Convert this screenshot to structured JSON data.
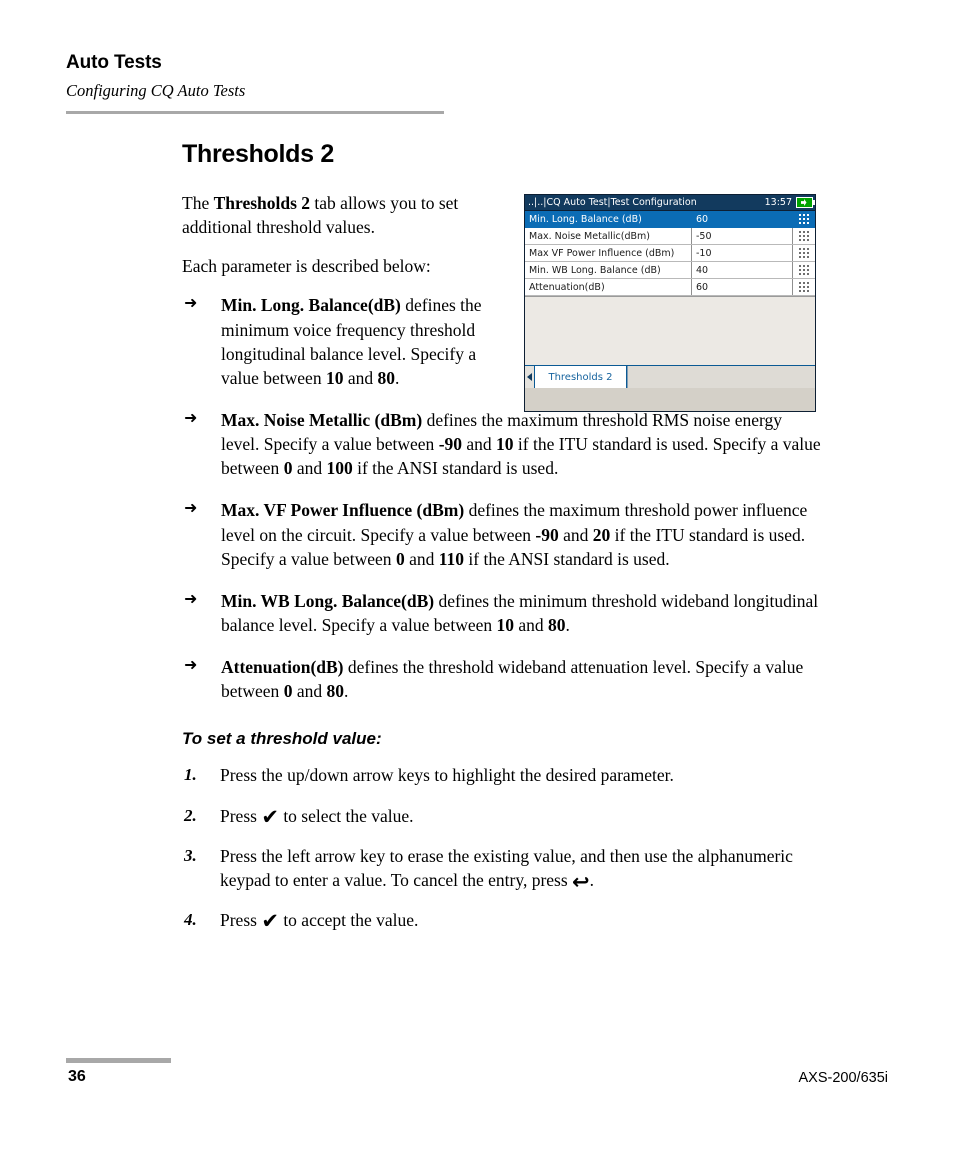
{
  "header": {
    "title": "Auto Tests",
    "subtitle": "Configuring CQ Auto Tests"
  },
  "main": {
    "section_heading": "Thresholds 2",
    "intro_p1_pre": "The ",
    "intro_p1_bold": "Thresholds 2",
    "intro_p1_post": " tab allows you to set additional threshold values.",
    "intro_p2": "Each parameter is described below:",
    "bullet_marker": "➜"
  },
  "bullets": [
    {
      "term": "Min. Long. Balance(dB)",
      "text_1": " defines the minimum voice frequency threshold longitudinal balance level. Specify a value between ",
      "v1": "10",
      "text_2": " and ",
      "v2": "80",
      "text_3": "."
    },
    {
      "term": "Max. Noise Metallic (dBm)",
      "text_1": " defines the maximum threshold RMS noise energy level. Specify a value between ",
      "v1": "-90",
      "text_2": " and ",
      "v2": "10",
      "text_3": " if the ITU standard is used. Specify a value between ",
      "v3": "0",
      "text_4": " and ",
      "v4": "100",
      "text_5": " if the ANSI standard is used."
    },
    {
      "term": "Max. VF Power Influence (dBm)",
      "text_1": " defines the maximum threshold power influence level on the circuit. Specify a value between ",
      "v1": "-90",
      "text_2": " and ",
      "v2": "20",
      "text_3": " if the ITU standard is used. Specify a value between ",
      "v3": "0",
      "text_4": " and ",
      "v4": "110",
      "text_5": " if the ANSI standard is used."
    },
    {
      "term": "Min. WB Long. Balance(dB)",
      "text_1": " defines the minimum threshold wideband longitudinal balance level. Specify a value between ",
      "v1": "10",
      "text_2": " and ",
      "v2": "80",
      "text_3": "."
    },
    {
      "term": "Attenuation(dB)",
      "text_1": " defines the threshold wideband attenuation level. Specify a value between ",
      "v1": "0",
      "text_2": " and ",
      "v2": "80",
      "text_3": "."
    }
  ],
  "procedure": {
    "heading": "To set a threshold value:",
    "steps": [
      {
        "num": "1.",
        "text_1": "Press the up/down arrow keys to highlight the desired parameter.",
        "glyph": "",
        "text_2": ""
      },
      {
        "num": "2.",
        "text_1": "Press ",
        "glyph": "✔",
        "text_2": " to select the value."
      },
      {
        "num": "3.",
        "text_1": "Press the left arrow key to erase the existing value, and then use the alphanumeric keypad to enter a value. To cancel the entry, press ",
        "glyph": "↩",
        "text_2": "."
      },
      {
        "num": "4.",
        "text_1": "Press ",
        "glyph": "✔",
        "text_2": " to accept the value."
      }
    ]
  },
  "device": {
    "titlebar_path": "..|..|CQ Auto Test|Test Configuration",
    "clock": "13:57",
    "battery_icon": "battery-charging-icon",
    "rows": [
      {
        "label": "Min. Long. Balance (dB)",
        "value": "60",
        "selected": true,
        "grip_icon": "grip-dots-icon"
      },
      {
        "label": "Max. Noise Metallic(dBm)",
        "value": "-50",
        "selected": false,
        "grip_icon": "grip-dots-icon"
      },
      {
        "label": "Max VF Power Influence (dBm)",
        "value": "-10",
        "selected": false,
        "grip_icon": "grip-dots-icon"
      },
      {
        "label": "Min. WB Long. Balance (dB)",
        "value": "40",
        "selected": false,
        "grip_icon": "grip-dots-icon"
      },
      {
        "label": "Attenuation(dB)",
        "value": "60",
        "selected": false,
        "grip_icon": "grip-dots-icon"
      }
    ],
    "tab_scroll_icon": "triangle-left-icon",
    "tab_label": "Thresholds 2",
    "colors": {
      "titlebar": "#123a5e",
      "selected_row": "#0b6cb5",
      "tab_text": "#16639e",
      "battery": "#00a300"
    }
  },
  "footer": {
    "page_number": "36",
    "model": "AXS-200/635i"
  }
}
